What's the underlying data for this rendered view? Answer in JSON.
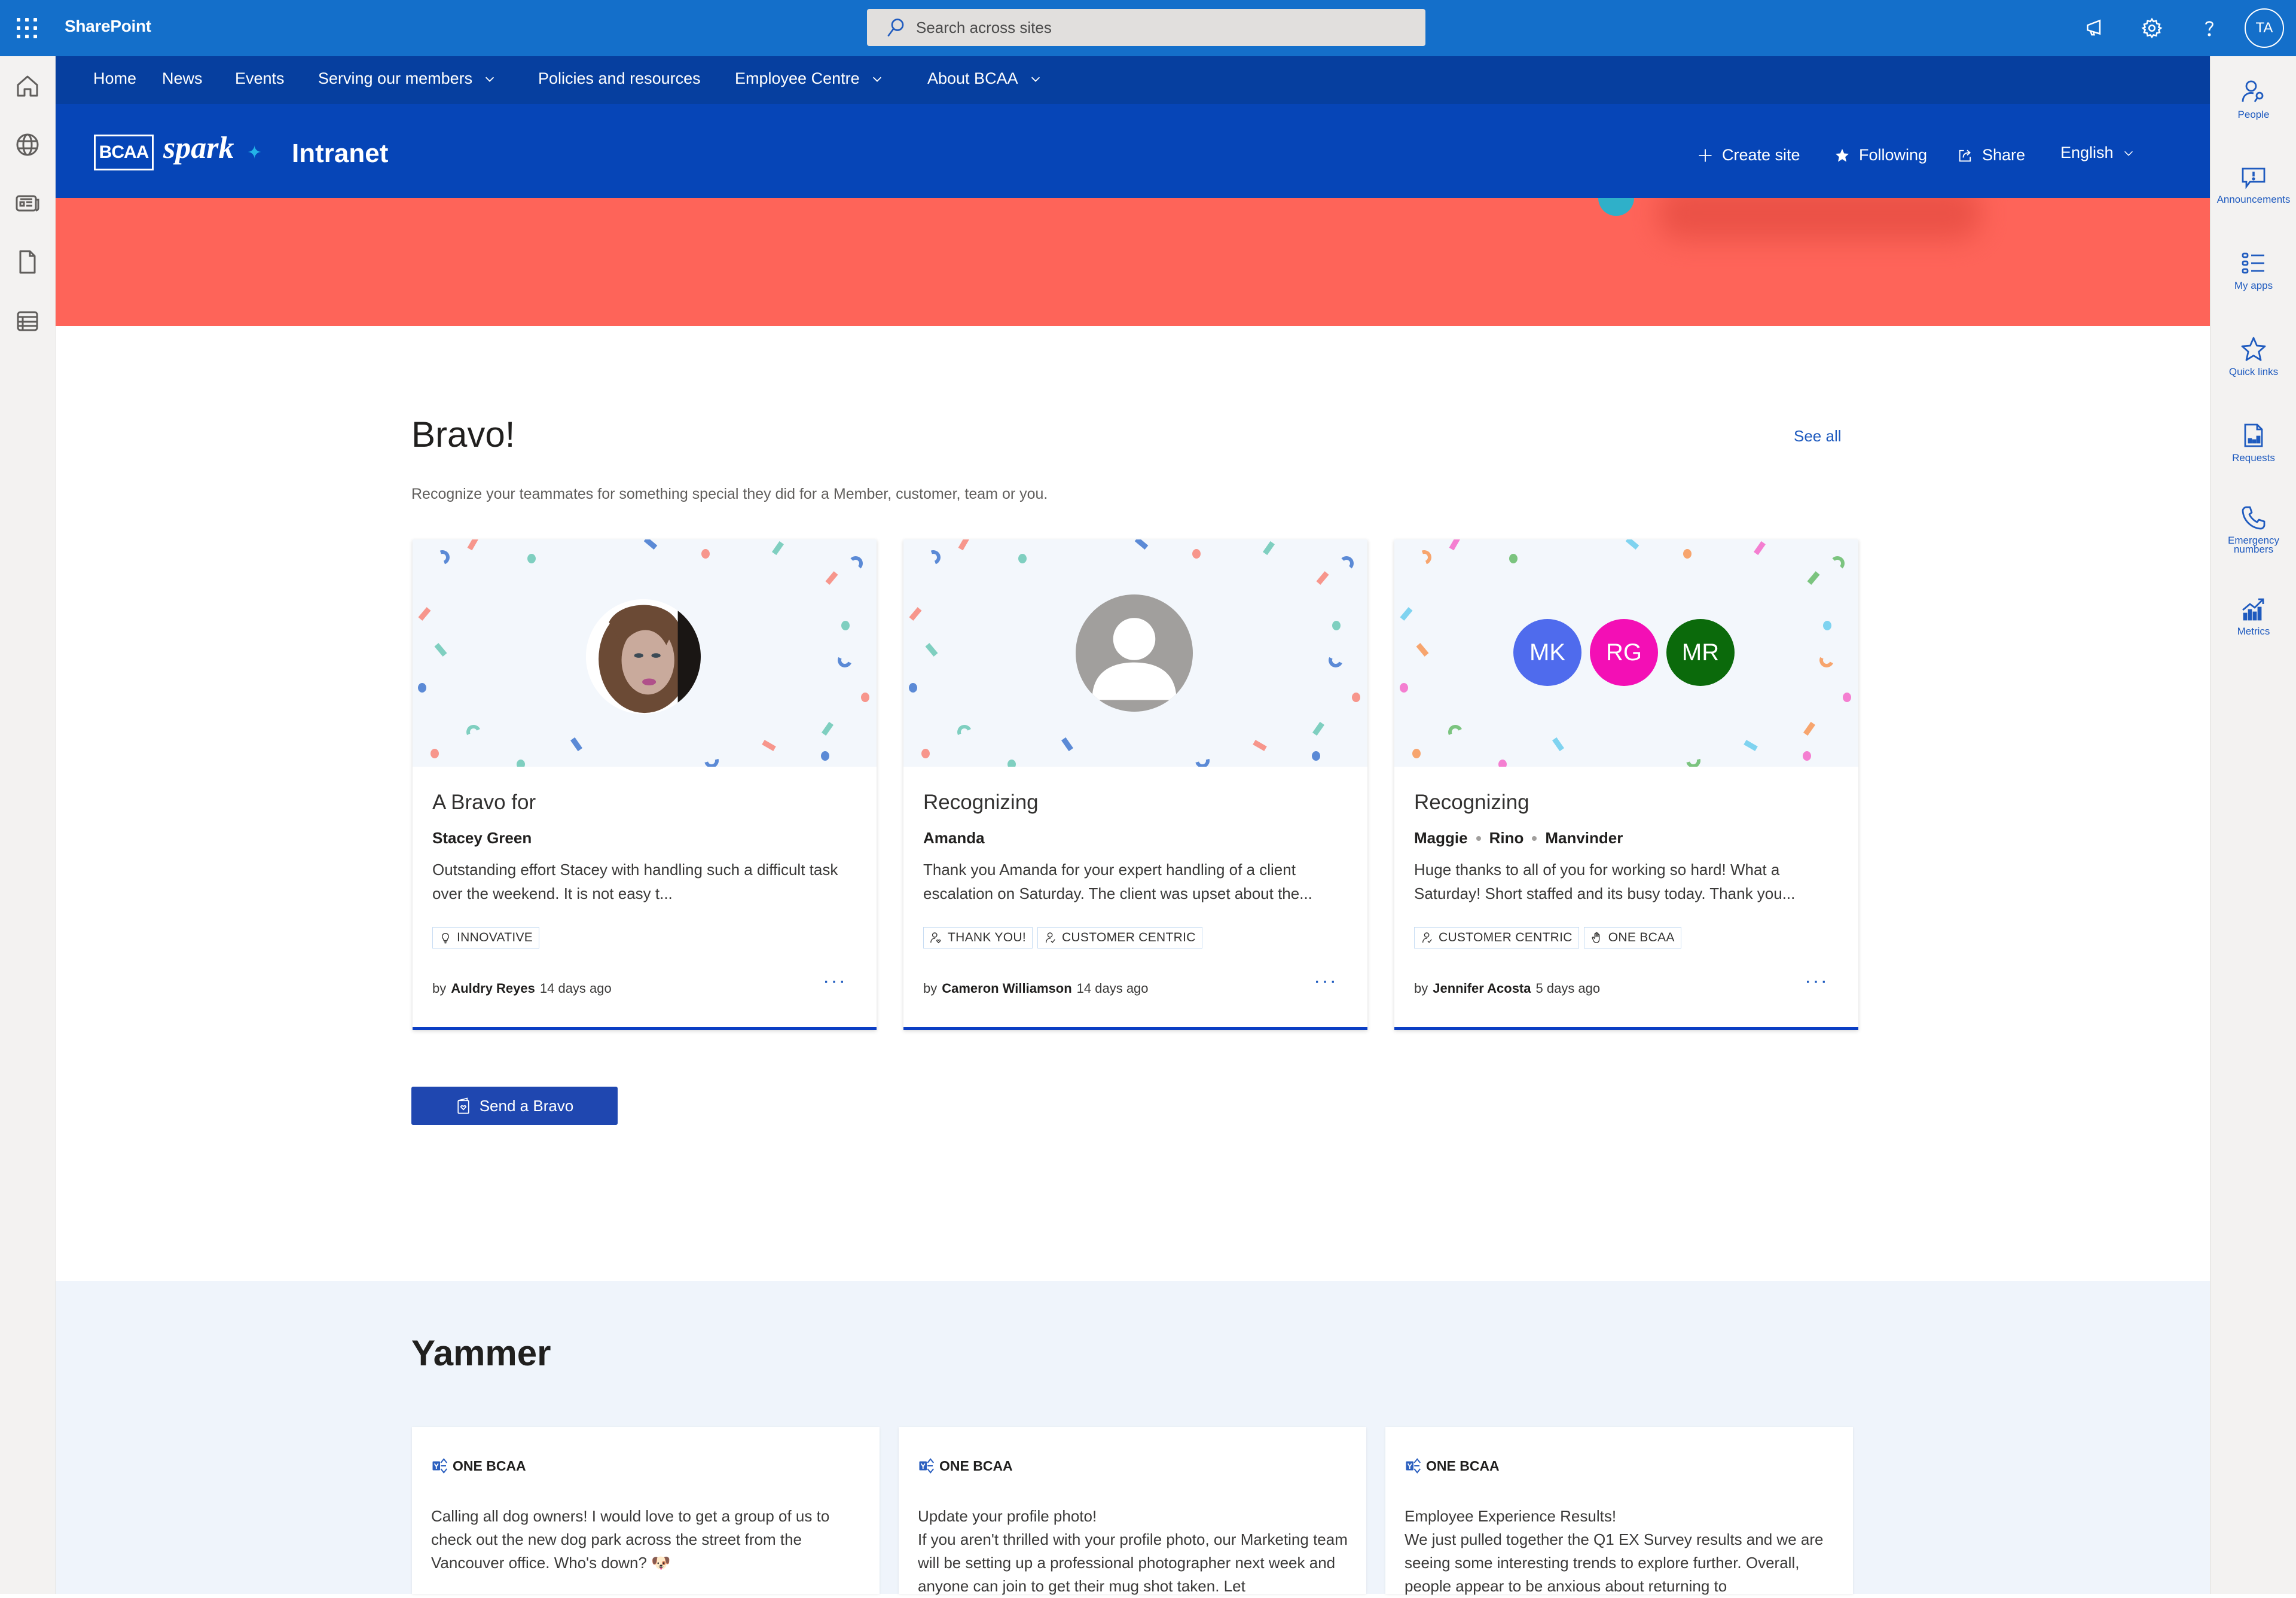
{
  "suitebar": {
    "app_name": "SharePoint",
    "search_placeholder": "Search across sites",
    "icons": [
      "megaphone-icon",
      "gear-icon",
      "help-icon"
    ],
    "user_initials": "TA"
  },
  "hubnav": {
    "items": [
      {
        "label": "Home",
        "has_dropdown": false
      },
      {
        "label": "News",
        "has_dropdown": false
      },
      {
        "label": "Events",
        "has_dropdown": false
      },
      {
        "label": "Serving our members",
        "has_dropdown": true
      },
      {
        "label": "Policies and resources",
        "has_dropdown": false
      },
      {
        "label": "Employee Centre",
        "has_dropdown": true
      },
      {
        "label": "About BCAA",
        "has_dropdown": true
      }
    ]
  },
  "siteheader": {
    "logo_text": "BCAA",
    "logo_spark": "spark",
    "logo_star": "✦",
    "title": "Intranet",
    "actions": {
      "create_site": "Create site",
      "following": "Following",
      "share": "Share",
      "language": "English"
    }
  },
  "leftbar": {
    "icons": [
      "home-icon",
      "globe-icon",
      "news-icon",
      "document-icon",
      "list-icon"
    ]
  },
  "rightrail": {
    "items": [
      {
        "label": "People",
        "icon": "people-search-icon"
      },
      {
        "label": "Announcements",
        "icon": "announcement-icon"
      },
      {
        "label": "My apps",
        "icon": "apps-list-icon"
      },
      {
        "label": "Quick links",
        "icon": "star-icon"
      },
      {
        "label": "Requests",
        "icon": "report-icon"
      },
      {
        "label": "Emergency numbers",
        "icon": "phone-icon"
      },
      {
        "label": "Metrics",
        "icon": "chart-icon"
      }
    ]
  },
  "bravo": {
    "title": "Bravo!",
    "see_all": "See all",
    "subtitle": "Recognize your teammates for something special they did for a Member, customer, team or you.",
    "cards": [
      {
        "heading": "A Bravo for",
        "names": [
          "Stacey Green"
        ],
        "message": "Outstanding effort Stacey with handling such a difficult task over the weekend. It is not easy t...",
        "tags": [
          {
            "label": "INNOVATIVE",
            "icon": "lightbulb-icon"
          }
        ],
        "by": "by",
        "author": "Auldry Reyes",
        "time": "14 days ago",
        "avatar": "photo",
        "confetti_palette": [
          "#5b8ad6",
          "#f7968c",
          "#7fcfc0"
        ]
      },
      {
        "heading": "Recognizing",
        "names": [
          "Amanda"
        ],
        "message": "Thank you Amanda for your expert handling of a client escalation on Saturday. The client was upset about the...",
        "tags": [
          {
            "label": "THANK YOU!",
            "icon": "person-heart-icon"
          },
          {
            "label": "CUSTOMER CENTRIC",
            "icon": "person-check-icon"
          }
        ],
        "by": "by",
        "author": "Cameron Williamson",
        "time": "14 days ago",
        "avatar": "generic",
        "confetti_palette": [
          "#5b8ad6",
          "#f7968c",
          "#7fcfc0"
        ]
      },
      {
        "heading": "Recognizing",
        "names": [
          "Maggie",
          "Rino",
          "Manvinder"
        ],
        "message": "Huge thanks to all of you for working so hard! What a Saturday! Short staffed and its busy today. Thank you...",
        "tags": [
          {
            "label": "CUSTOMER CENTRIC",
            "icon": "person-check-icon"
          },
          {
            "label": "ONE BCAA",
            "icon": "hand-icon"
          }
        ],
        "by": "by",
        "author": "Jennifer Acosta",
        "time": "5 days ago",
        "avatar": "initials",
        "initials": [
          {
            "text": "MK",
            "color": "#4f6bed"
          },
          {
            "text": "RG",
            "color": "#f30fb5"
          },
          {
            "text": "MR",
            "color": "#0b6a0b"
          }
        ],
        "confetti_palette": [
          "#f7a56e",
          "#f47fd1",
          "#7bc47f",
          "#7fd3f0"
        ]
      }
    ],
    "send_button": "Send a Bravo"
  },
  "yammer": {
    "title": "Yammer",
    "cards": [
      {
        "group": "ONE BCAA",
        "body": "Calling all dog owners! I would love to get a group of us to check out the new dog park across the street from the Vancouver office. Who's down? 🐶"
      },
      {
        "group": "ONE BCAA",
        "body": "Update your profile photo!\nIf you aren't thrilled with your profile photo, our Marketing team will be setting up a professional photographer next week and anyone can join to get their mug shot taken. Let"
      },
      {
        "group": "ONE BCAA",
        "body": "Employee Experience Results!\nWe just pulled together the Q1 EX Survey results and we are seeing some interesting trends to explore further. Overall, people appear to be anxious about returning to"
      }
    ]
  },
  "colors": {
    "suitebar": "#146fca",
    "hubnav": "#063f9f",
    "siteheader": "#0645b7",
    "banner": "#fe6459",
    "accent": "#1f5bbf",
    "button": "#1f47b0",
    "yammer_bg": "#eff4fb"
  }
}
